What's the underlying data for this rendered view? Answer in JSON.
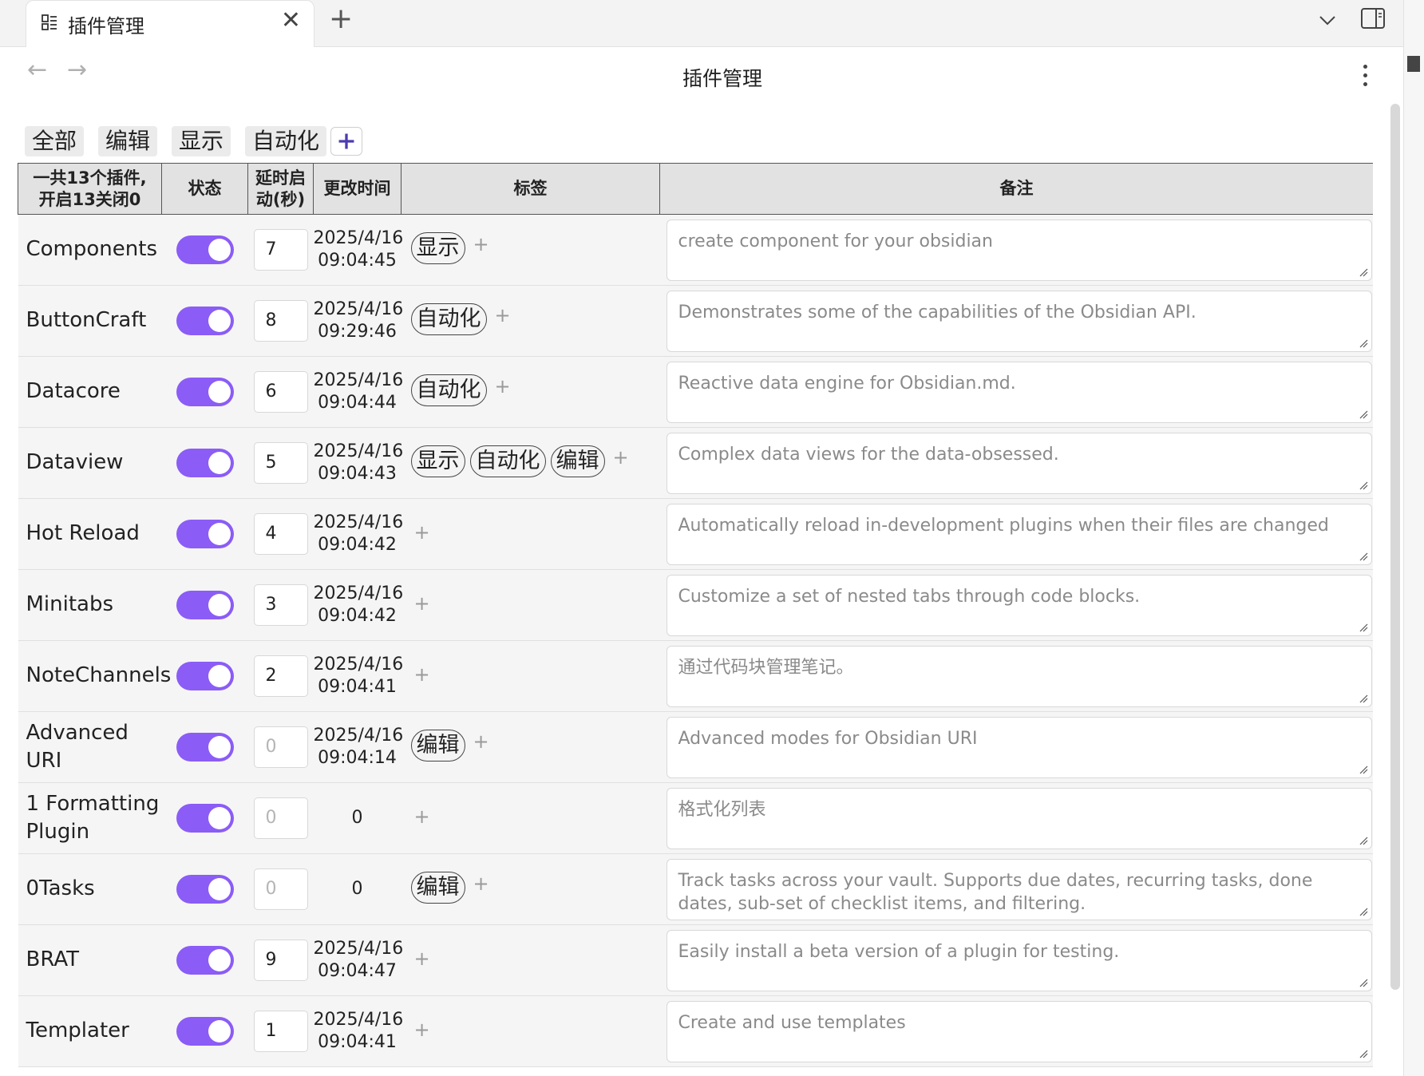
{
  "tab": {
    "title": "插件管理",
    "close_label": "✕",
    "new_tab_label": "+"
  },
  "nav": {
    "back_label": "←",
    "forward_label": "→",
    "page_title": "插件管理"
  },
  "filters": [
    "全部",
    "编辑",
    "显示",
    "自动化"
  ],
  "table": {
    "headers": {
      "name_line1": "一共13个插件,",
      "name_line2": "开启13关闭0",
      "state": "状态",
      "delay_line1": "延时启",
      "delay_line2": "动(秒)",
      "time": "更改时间",
      "tags": "标签",
      "note": "备注"
    },
    "rows": [
      {
        "name": "Components",
        "enabled": true,
        "delay": "7",
        "date": "2025/4/16",
        "time": "09:04:45",
        "tags": [
          "显示"
        ],
        "note": "create component for your obsidian"
      },
      {
        "name": "ButtonCraft",
        "enabled": true,
        "delay": "8",
        "date": "2025/4/16",
        "time": "09:29:46",
        "tags": [
          "自动化"
        ],
        "note": "Demonstrates some of the capabilities of the Obsidian API."
      },
      {
        "name": "Datacore",
        "enabled": true,
        "delay": "6",
        "date": "2025/4/16",
        "time": "09:04:44",
        "tags": [
          "自动化"
        ],
        "note": "Reactive data engine for Obsidian.md."
      },
      {
        "name": "Dataview",
        "enabled": true,
        "delay": "5",
        "date": "2025/4/16",
        "time": "09:04:43",
        "tags": [
          "显示",
          "自动化",
          "编辑"
        ],
        "note": "Complex data views for the data-obsessed."
      },
      {
        "name": "Hot Reload",
        "enabled": true,
        "delay": "4",
        "date": "2025/4/16",
        "time": "09:04:42",
        "tags": [],
        "note": "Automatically reload in-development plugins when their files are changed"
      },
      {
        "name": "Minitabs",
        "enabled": true,
        "delay": "3",
        "date": "2025/4/16",
        "time": "09:04:42",
        "tags": [],
        "note": "Customize a set of nested tabs through code blocks."
      },
      {
        "name": "NoteChannels",
        "enabled": true,
        "delay": "2",
        "date": "2025/4/16",
        "time": "09:04:41",
        "tags": [],
        "note": "通过代码块管理笔记。"
      },
      {
        "name": "Advanced URI",
        "enabled": true,
        "delay": "0",
        "date": "2025/4/16",
        "time": "09:04:14",
        "tags": [
          "编辑"
        ],
        "note": "Advanced modes for Obsidian URI"
      },
      {
        "name": "1 Formatting Plugin",
        "enabled": true,
        "delay": "0",
        "date": "0",
        "time": "",
        "tags": [],
        "note": "格式化列表"
      },
      {
        "name": "0Tasks",
        "enabled": true,
        "delay": "0",
        "date": "0",
        "time": "",
        "tags": [
          "编辑"
        ],
        "note": "Track tasks across your vault. Supports due dates, recurring tasks, done dates, sub-set of checklist items, and filtering."
      },
      {
        "name": "BRAT",
        "enabled": true,
        "delay": "9",
        "date": "2025/4/16",
        "time": "09:04:47",
        "tags": [],
        "note": "Easily install a beta version of a plugin for testing."
      },
      {
        "name": "Templater",
        "enabled": true,
        "delay": "1",
        "date": "2025/4/16",
        "time": "09:04:41",
        "tags": [],
        "note": "Create and use templates"
      }
    ]
  },
  "colors": {
    "toggle_on": "#8b5cf6",
    "header_bg": "#e2e2e2",
    "row_bg": "#f5f5f5"
  }
}
